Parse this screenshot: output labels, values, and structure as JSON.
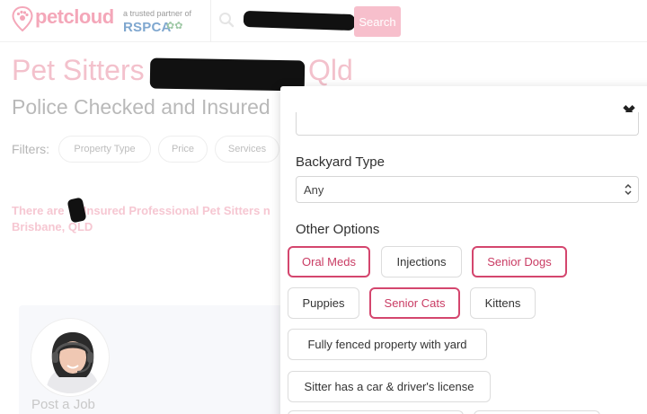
{
  "header": {
    "logo_text": "petcloud",
    "partner_text": "a trusted partner of",
    "partner_name": "RSPCA",
    "search_placeholder": "",
    "search_value": "",
    "search_button": "Search"
  },
  "page": {
    "title_left": "Pet Sitters",
    "title_right": "Qld",
    "subtitle": "Police Checked and Insured",
    "filters_label": "Filters:",
    "filters": [
      {
        "label": "Property Type"
      },
      {
        "label": "Price"
      },
      {
        "label": "Services"
      }
    ],
    "result_line_1a": "There are",
    "result_line_1b": "Insured Professional Pet Sitters n",
    "result_line_2": "Brisbane, QLD",
    "post_job": "Post a Job"
  },
  "modal": {
    "close_icon": "close-icon",
    "backyard_label": "Backyard Type",
    "backyard_value": "Any",
    "other_options_label": "Other Options",
    "options": [
      {
        "label": "Oral Meds",
        "selected": true
      },
      {
        "label": "Injections",
        "selected": false
      },
      {
        "label": "Senior Dogs",
        "selected": true
      },
      {
        "label": "Puppies",
        "selected": false
      },
      {
        "label": "Senior Cats",
        "selected": true
      },
      {
        "label": "Kittens",
        "selected": false
      },
      {
        "label": "Fully fenced property with yard",
        "selected": false
      },
      {
        "label": "Sitter has a car & driver's license",
        "selected": false
      }
    ]
  },
  "colors": {
    "brand_pink": "#f4a7b9",
    "selected_border": "#d4466e",
    "search_button": "#f7bfcc"
  }
}
